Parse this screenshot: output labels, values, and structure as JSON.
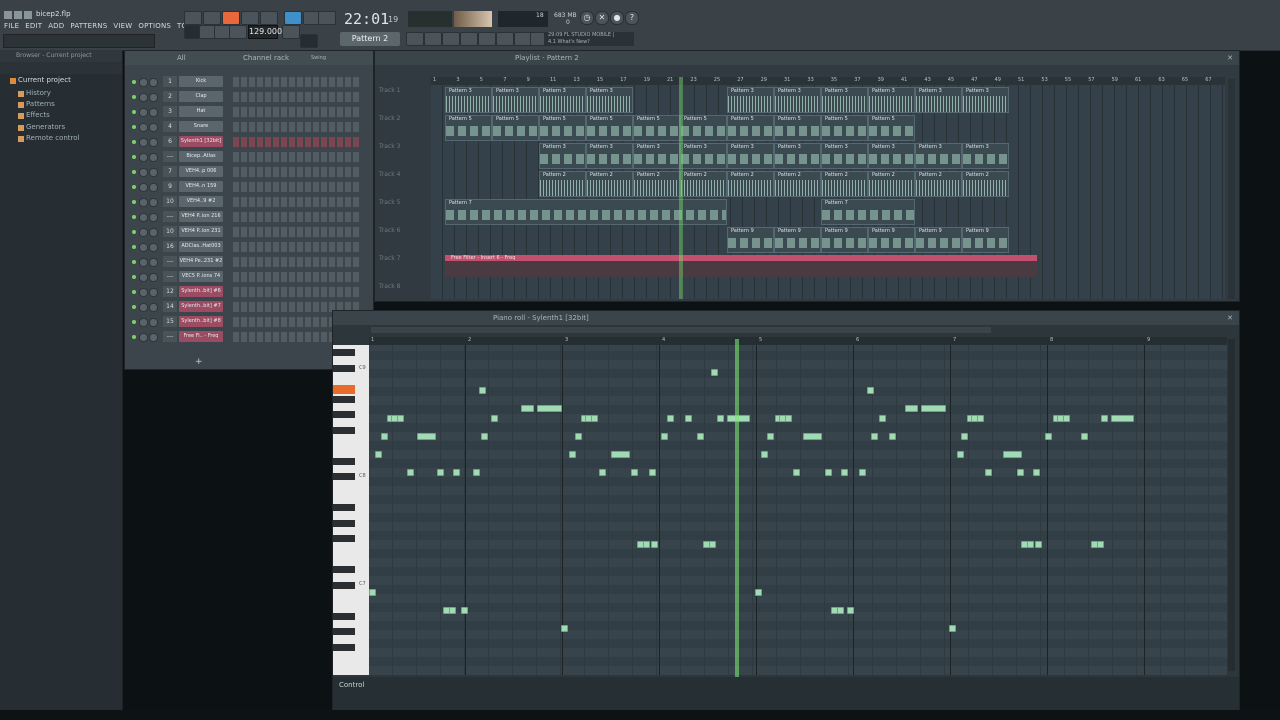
{
  "app": {
    "file_name": "bicep2.flp",
    "menu": [
      "FILE",
      "EDIT",
      "ADD",
      "PATTERNS",
      "VIEW",
      "OPTIONS",
      "TOOLS",
      "?"
    ]
  },
  "transport": {
    "tempo": "129.000",
    "time_main": "22:01",
    "time_sub": "19",
    "pattern_label": "Pattern 2",
    "cpu_value": "18",
    "memory": "683 MB",
    "voices": "0",
    "news_line1": "29:09  FL STUDIO MOBILE |",
    "news_line2": "4.1 What's New?"
  },
  "browser": {
    "header": "Browser - Current project",
    "root": "Current project",
    "items": [
      "History",
      "Patterns",
      "Effects",
      "Generators",
      "Remote control"
    ]
  },
  "channel_rack": {
    "title": "Channel rack",
    "filter": "All",
    "swing_label": "Swing",
    "channels": [
      {
        "num": "1",
        "name": "Kick"
      },
      {
        "num": "2",
        "name": "Clap"
      },
      {
        "num": "3",
        "name": "Hat"
      },
      {
        "num": "4",
        "name": "Snare"
      },
      {
        "num": "6",
        "name": "Sylenth1 [32bit]"
      },
      {
        "num": "---",
        "name": "Bicep..Atlas"
      },
      {
        "num": "7",
        "name": "VEH4..p 006"
      },
      {
        "num": "9",
        "name": "VEH4..n 159"
      },
      {
        "num": "10",
        "name": "VEH4..9 #2"
      },
      {
        "num": "---",
        "name": "VEH4 P..ion 216"
      },
      {
        "num": "10",
        "name": "VEH4 P..ion 231"
      },
      {
        "num": "16",
        "name": "ADClas..Hat003"
      },
      {
        "num": "---",
        "name": "VEH4 Pe..231 #2"
      },
      {
        "num": "---",
        "name": "VEC5 P..ions 74"
      },
      {
        "num": "12",
        "name": "Sylenth..bit] #6"
      },
      {
        "num": "14",
        "name": "Sylenth..bit] #7"
      },
      {
        "num": "15",
        "name": "Sylenth..bit] #8"
      },
      {
        "num": "---",
        "name": "Free Fi.. - Freq"
      }
    ]
  },
  "playlist": {
    "title": "Playlist - Pattern 2",
    "ruler": [
      "1",
      "3",
      "5",
      "7",
      "9",
      "11",
      "13",
      "15",
      "17",
      "19",
      "21",
      "23",
      "25",
      "27",
      "29",
      "31",
      "33",
      "35",
      "37",
      "39",
      "41",
      "43",
      "45",
      "47",
      "49",
      "51",
      "53",
      "55",
      "57",
      "59",
      "61",
      "63",
      "65",
      "67"
    ],
    "tracks": [
      "Track 1",
      "Track 2",
      "Track 3",
      "Track 4",
      "Track 5",
      "Track 6",
      "Track 7",
      "Track 8"
    ],
    "clip_names": {
      "p3": "Pattern 3",
      "p5": "Pattern 5",
      "p2": "Pattern 2",
      "p7": "Pattern 7",
      "p9": "Pattern 9",
      "auto": "Free Filter - Insert 6 - Freq"
    }
  },
  "piano_roll": {
    "title": "Piano roll - Sylenth1 [32bit]",
    "bars": [
      "1",
      "2",
      "3",
      "4",
      "5",
      "6",
      "7",
      "8",
      "9"
    ],
    "octaves": [
      "C9",
      "C8",
      "C7"
    ],
    "control_label": "Control"
  }
}
